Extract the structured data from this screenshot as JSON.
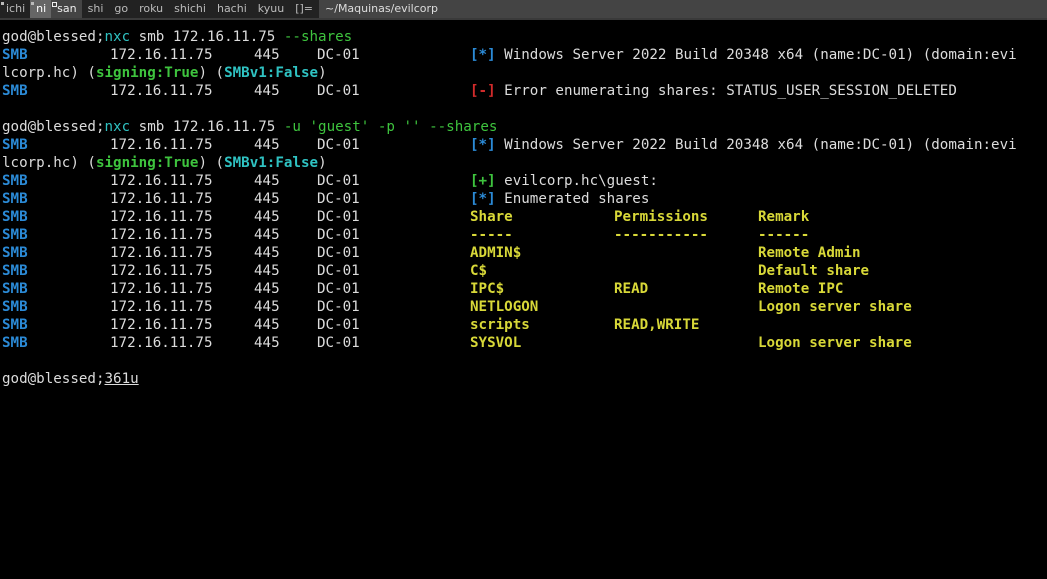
{
  "statusbar": {
    "tags": [
      "ichi",
      "ni",
      "san",
      "shi",
      "go",
      "roku",
      "shichi",
      "hachi",
      "kyuu"
    ],
    "layout": "[]=",
    "window_title": "~/Maquinas/evilcorp"
  },
  "prompt": "god@blessed;",
  "commands": [
    {
      "tool": "nxc",
      "args": " smb 172.16.11.75 ",
      "flags": "--shares"
    },
    {
      "tool": "nxc",
      "args": " smb 172.16.11.75 ",
      "flags": "-u 'guest' -p '' --shares"
    }
  ],
  "smb": {
    "proto": "SMB",
    "ip": "172.16.11.75",
    "port": "445",
    "host": "DC-01"
  },
  "info_banner": {
    "marker": "[*]",
    "text": " Windows Server 2022 Build 20348 x64 (name:DC-01) (domain:evi",
    "wrap_text": "lcorp.hc) (",
    "signing_label": "signing:True",
    "mid": ") (",
    "smbv1_label": "SMBv1:False",
    "end": ")"
  },
  "error": {
    "marker": "[-]",
    "text": " Error enumerating shares: STATUS_USER_SESSION_DELETED"
  },
  "auth": {
    "marker": "[+]",
    "text": " evilcorp.hc\\guest:"
  },
  "enum": {
    "marker": "[*]",
    "text": " Enumerated shares"
  },
  "shares_table": {
    "headers": [
      "Share",
      "Permissions",
      "Remark"
    ],
    "separators": [
      "-----",
      "-----------",
      "------"
    ],
    "rows": [
      {
        "share": "ADMIN$",
        "perm": "",
        "remark": "Remote Admin"
      },
      {
        "share": "C$",
        "perm": "",
        "remark": "Default share"
      },
      {
        "share": "IPC$",
        "perm": "READ",
        "remark": "Remote IPC"
      },
      {
        "share": "NETLOGON",
        "perm": "",
        "remark": "Logon server share"
      },
      {
        "share": "scripts",
        "perm": "READ,WRITE",
        "remark": ""
      },
      {
        "share": "SYSVOL",
        "perm": "",
        "remark": "Logon server share"
      }
    ]
  },
  "final_prompt_input": "361u",
  "colors": {
    "background": "#000000",
    "smb_blue": "#2b8ad6",
    "green": "#3ec43e",
    "red": "#d22b2b",
    "yellow": "#d8d838",
    "cyan": "#2fc2c2"
  }
}
